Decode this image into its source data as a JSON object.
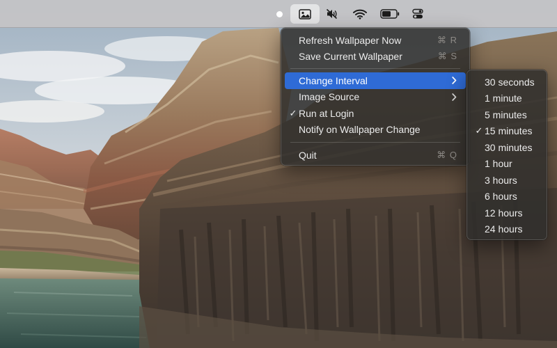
{
  "menubar": {
    "icons": [
      "status-dot",
      "image-icon",
      "speaker-muted-icon",
      "wifi-icon",
      "battery-icon",
      "control-center-icon"
    ]
  },
  "main_menu": {
    "items": [
      {
        "label": "Refresh Wallpaper Now",
        "shortcut": "⌘ R"
      },
      {
        "label": "Save Current Wallpaper",
        "shortcut": "⌘ S"
      },
      {
        "label": "Change Interval",
        "submenu": true,
        "highlighted": true
      },
      {
        "label": "Image Source",
        "submenu": true
      },
      {
        "label": "Run at Login",
        "checked": true
      },
      {
        "label": "Notify on Wallpaper Change"
      },
      {
        "label": "Quit",
        "shortcut": "⌘ Q"
      }
    ]
  },
  "interval_submenu": {
    "items": [
      {
        "label": "30 seconds"
      },
      {
        "label": "1 minute"
      },
      {
        "label": "5 minutes"
      },
      {
        "label": "15 minutes",
        "checked": true
      },
      {
        "label": "30 minutes"
      },
      {
        "label": "1 hour"
      },
      {
        "label": "3 hours"
      },
      {
        "label": "6 hours"
      },
      {
        "label": "12 hours"
      },
      {
        "label": "24 hours"
      }
    ]
  },
  "colors": {
    "highlight": "#2f6bd6",
    "menu_background": "#302e2c",
    "menubar_background": "#c4c4c6"
  }
}
